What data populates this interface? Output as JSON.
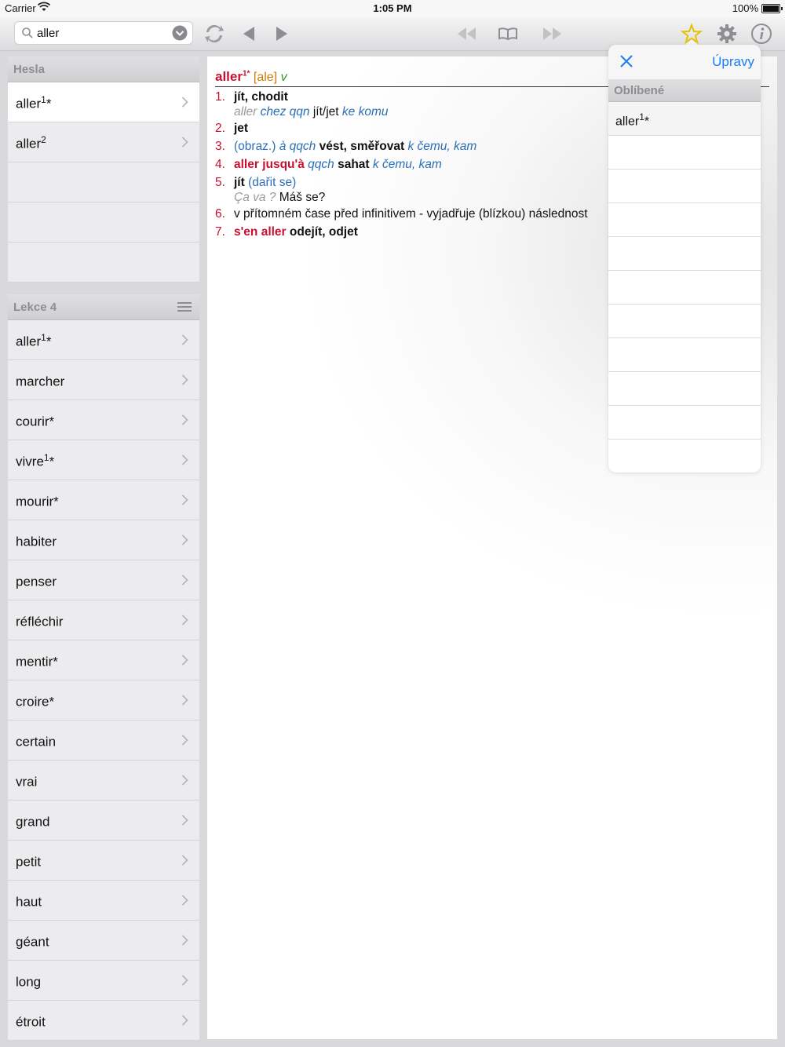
{
  "status": {
    "carrier": "Carrier",
    "time": "1:05 PM",
    "battery": "100%"
  },
  "search": {
    "value": "aller"
  },
  "hesla": {
    "title": "Hesla",
    "items": [
      {
        "label": "aller",
        "sup": "1",
        "suffix": "*"
      },
      {
        "label": "aller",
        "sup": "2",
        "suffix": ""
      }
    ]
  },
  "lekce": {
    "title": "Lekce 4",
    "items": [
      {
        "label": "aller",
        "sup": "1",
        "suffix": "*"
      },
      {
        "label": "marcher",
        "sup": "",
        "suffix": ""
      },
      {
        "label": "courir*",
        "sup": "",
        "suffix": ""
      },
      {
        "label": "vivre",
        "sup": "1",
        "suffix": "*"
      },
      {
        "label": "mourir*",
        "sup": "",
        "suffix": ""
      },
      {
        "label": "habiter",
        "sup": "",
        "suffix": ""
      },
      {
        "label": "penser",
        "sup": "",
        "suffix": ""
      },
      {
        "label": "réfléchir",
        "sup": "",
        "suffix": ""
      },
      {
        "label": "mentir*",
        "sup": "",
        "suffix": ""
      },
      {
        "label": "croire*",
        "sup": "",
        "suffix": ""
      },
      {
        "label": "certain",
        "sup": "",
        "suffix": ""
      },
      {
        "label": "vrai",
        "sup": "",
        "suffix": ""
      },
      {
        "label": "grand",
        "sup": "",
        "suffix": ""
      },
      {
        "label": "petit",
        "sup": "",
        "suffix": ""
      },
      {
        "label": "haut",
        "sup": "",
        "suffix": ""
      },
      {
        "label": "géant",
        "sup": "",
        "suffix": ""
      },
      {
        "label": "long",
        "sup": "",
        "suffix": ""
      },
      {
        "label": "étroit",
        "sup": "",
        "suffix": ""
      }
    ]
  },
  "entry": {
    "headword": "aller",
    "headword_sup": "1*",
    "pronunciation": "[ale]",
    "pos": "v",
    "defs": {
      "d1": {
        "num": "1.",
        "main": "jít, chodit",
        "ex_gray": "aller",
        "ex_blue1": "chez qqn",
        "ex_text": "jít/jet",
        "ex_blue2": "ke komu"
      },
      "d2": {
        "num": "2.",
        "main": "jet"
      },
      "d3": {
        "num": "3.",
        "blue": "(obraz.)",
        "blue_i": "à qqch",
        "main": "vést, směřovat",
        "blue_i2": "k čemu, kam"
      },
      "d4": {
        "num": "4.",
        "red": "aller jusqu'à",
        "blue_i": "qqch",
        "main": "sahat",
        "blue_i2": "k čemu, kam"
      },
      "d5": {
        "num": "5.",
        "main": "jít",
        "blue": "(dařit se)",
        "ex_gray": "Ça va ?",
        "ex_text": "Máš se?"
      },
      "d6": {
        "num": "6.",
        "text": "v přítomném čase před infinitivem - vyjadřuje (blízkou) následnost"
      },
      "d7": {
        "num": "7.",
        "red": "s'en aller",
        "main": "odejít, odjet"
      }
    }
  },
  "favorites": {
    "edit": "Úpravy",
    "title": "Oblíbené",
    "items": [
      {
        "label": "aller",
        "sup": "1",
        "suffix": "*"
      }
    ],
    "empty_rows": 10
  },
  "icons": {
    "search": "search-icon",
    "dropdown": "chevron-down-circle-icon",
    "sync": "sync-icon",
    "back": "back-arrow-icon",
    "forward": "forward-arrow-icon",
    "rewind": "rewind-icon",
    "book": "book-icon",
    "fast_forward": "fast-forward-icon",
    "star": "star-icon",
    "gear": "gear-icon",
    "info": "info-icon",
    "close": "close-icon"
  },
  "colors": {
    "accent": "#1a7ef2",
    "headword": "#c8102e",
    "pron": "#cc7a00",
    "pos": "#2a9a2a",
    "translation_blue": "#2a6fb7",
    "star": "#e6c200"
  }
}
